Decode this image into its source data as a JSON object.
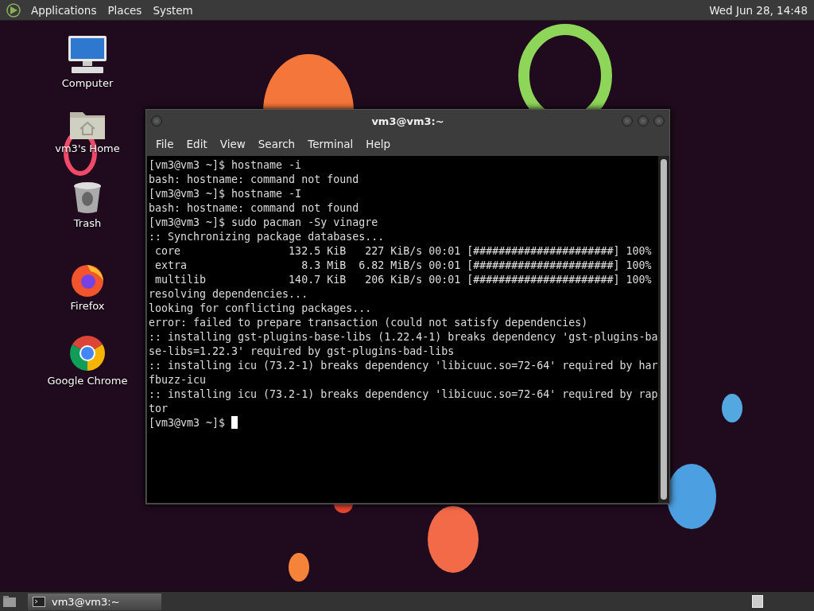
{
  "top_panel": {
    "menus": [
      "Applications",
      "Places",
      "System"
    ],
    "clock": "Wed Jun 28, 14:48"
  },
  "desktop_icons": [
    {
      "kind": "computer",
      "label": "Computer"
    },
    {
      "kind": "home",
      "label": "vm3's Home"
    },
    {
      "kind": "trash",
      "label": "Trash"
    },
    {
      "kind": "firefox",
      "label": "Firefox"
    },
    {
      "kind": "chrome",
      "label": "Google Chrome"
    }
  ],
  "window": {
    "title": "vm3@vm3:~",
    "menu": [
      "File",
      "Edit",
      "View",
      "Search",
      "Terminal",
      "Help"
    ],
    "terminal_lines": [
      "[vm3@vm3 ~]$ hostname -i",
      "bash: hostname: command not found",
      "[vm3@vm3 ~]$ hostname -I",
      "bash: hostname: command not found",
      "[vm3@vm3 ~]$ sudo pacman -Sy vinagre",
      ":: Synchronizing package databases...",
      " core                 132.5 KiB   227 KiB/s 00:01 [######################] 100%",
      " extra                  8.3 MiB  6.82 MiB/s 00:01 [######################] 100%",
      " multilib             140.7 KiB   206 KiB/s 00:01 [######################] 100%",
      "resolving dependencies...",
      "looking for conflicting packages...",
      "error: failed to prepare transaction (could not satisfy dependencies)",
      ":: installing gst-plugins-base-libs (1.22.4-1) breaks dependency 'gst-plugins-ba",
      "se-libs=1.22.3' required by gst-plugins-bad-libs",
      ":: installing icu (73.2-1) breaks dependency 'libicuuc.so=72-64' required by har",
      "fbuzz-icu",
      ":: installing icu (73.2-1) breaks dependency 'libicuuc.so=72-64' required by rap",
      "tor"
    ],
    "prompt": "[vm3@vm3 ~]$"
  },
  "taskbar": {
    "tasks": [
      {
        "label": "vm3@vm3:~",
        "selected": true
      }
    ]
  }
}
